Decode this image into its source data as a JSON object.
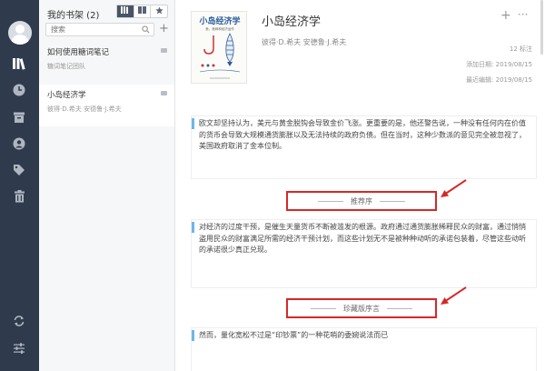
{
  "rail": {
    "icons": [
      "library-icon",
      "clock-icon",
      "archive-icon",
      "user-circle-icon",
      "tag-icon",
      "trash-icon"
    ],
    "bottom_icons": [
      "sync-icon",
      "settings-sliders-icon"
    ]
  },
  "shelf": {
    "header": "我的书架 (2)",
    "search_placeholder": "搜索",
    "add_label": "+",
    "books": [
      {
        "title": "如何使用糖词笔记",
        "author": "糖词笔记团队",
        "active": false
      },
      {
        "title": "小岛经济学",
        "author": "彼得·D.希夫 安德鲁·J.希夫",
        "active": true
      }
    ]
  },
  "main": {
    "cover": {
      "title": "小岛经济学",
      "subtitle": "鱼、渔网和经济运作"
    },
    "title": "小岛经济学",
    "author": "彼得·D.希夫 安德鲁·J.希夫",
    "add_label": "+",
    "more_label": "···",
    "note_count": "12 标注",
    "added": "添加日期: 2019/08/15",
    "edited": "最近编辑: 2019/08/15",
    "notes": [
      "欧文却坚持认为，美元与黄金脱钩会导致金价飞涨。更重要的是，他还警告说，一种没有任何内在价值的货币会导致大规模通货膨胀以及无法持续的政府负债。但在当时，这种少数派的意见完全被忽视了，美国政府取消了金本位制。",
      "对经济的过度干预，是催生天量货币不断被滥发的根源。政府通过通货膨胀稀释民众的财富，通过悄悄盗用民众的财富满足所需的经济干预计划，而这些计划无不是被种种动听的承诺包装着，尽管这些动听的承诺很少真正兑现。",
      "然而，量化宽松不过是“印钞票”的一种花哨的委婉说法而已"
    ],
    "sections": [
      "推荐序",
      "珍藏版序言"
    ]
  },
  "colors": {
    "rail_bg": "#2f3b4c",
    "accent_bar": "#6db6e8",
    "highlight_red": "#d62828"
  }
}
